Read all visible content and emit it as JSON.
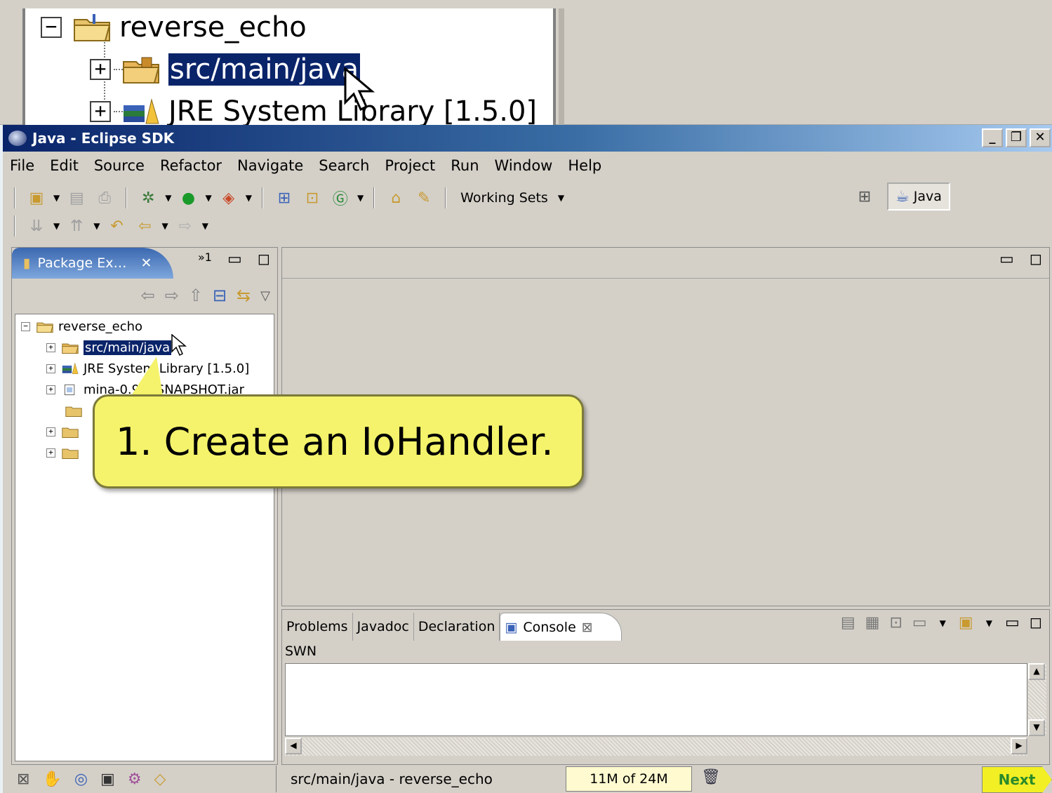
{
  "zoom_tree": {
    "project": "reverse_echo",
    "src_folder": "src/main/java",
    "jre_library": "JRE System Library [1.5.0]",
    "expand_collapse": "−",
    "expand": "+"
  },
  "window": {
    "title": "Java - Eclipse SDK",
    "minimize": "_",
    "restore": "❐",
    "close": "✕"
  },
  "menu": [
    "File",
    "Edit",
    "Source",
    "Refactor",
    "Navigate",
    "Search",
    "Project",
    "Run",
    "Window",
    "Help"
  ],
  "toolbar": {
    "working_sets": "Working Sets"
  },
  "perspective": {
    "java_label": "Java"
  },
  "package_explorer": {
    "tab_label": "Package Ex…",
    "close": "✕",
    "overflow": "»1",
    "tree": {
      "project": "reverse_echo",
      "src_folder": "src/main/java",
      "jre_library": "JRE System Library [1.5.0]",
      "jar": "mina-0.9.4-SNAPSHOT.jar"
    }
  },
  "console": {
    "tabs": [
      "Problems",
      "Javadoc",
      "Declaration",
      "Console"
    ],
    "active_tab": "Console",
    "label": "SWN"
  },
  "status_bar": {
    "message": "src/main/java - reverse_echo",
    "heap": "11M of 24M"
  },
  "callout": {
    "text": "1. Create an IoHandler."
  },
  "next_button": "Next"
}
